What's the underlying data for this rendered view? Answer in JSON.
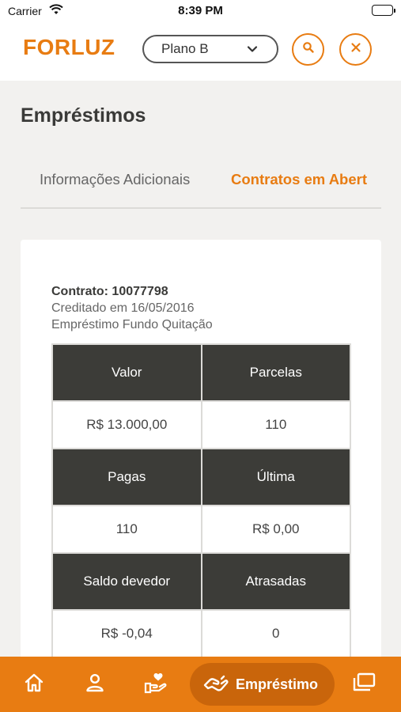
{
  "status_bar": {
    "carrier": "Carrier",
    "time": "8:39 PM"
  },
  "header": {
    "logo": "FORLUZ",
    "plan_select": "Plano B"
  },
  "page": {
    "title": "Empréstimos"
  },
  "tabs": [
    {
      "label": "Informações Adicionais",
      "active": false
    },
    {
      "label": "Contratos em Abert",
      "active": true
    }
  ],
  "contract": {
    "title": "Contrato: 10077798",
    "credited": "Creditado em 16/05/2016",
    "type": "Empréstimo Fundo Quitação",
    "table": {
      "h1": [
        "Valor",
        "Parcelas"
      ],
      "v1": [
        "R$ 13.000,00",
        "110"
      ],
      "h2": [
        "Pagas",
        "Última"
      ],
      "v2": [
        "110",
        "R$ 0,00"
      ],
      "h3": [
        "Saldo devedor",
        "Atrasadas"
      ],
      "v3": [
        "R$ -0,04",
        "0"
      ]
    }
  },
  "bottom_nav": {
    "items": [
      {
        "icon": "home-icon"
      },
      {
        "icon": "profile-icon"
      },
      {
        "icon": "benefits-icon"
      },
      {
        "icon": "loan-icon",
        "label": "Empréstimo",
        "active": true
      },
      {
        "icon": "documents-icon"
      }
    ]
  },
  "colors": {
    "accent": "#e87c12",
    "table_header": "#3c3c38",
    "active_nav_pill": "#c9650b"
  }
}
